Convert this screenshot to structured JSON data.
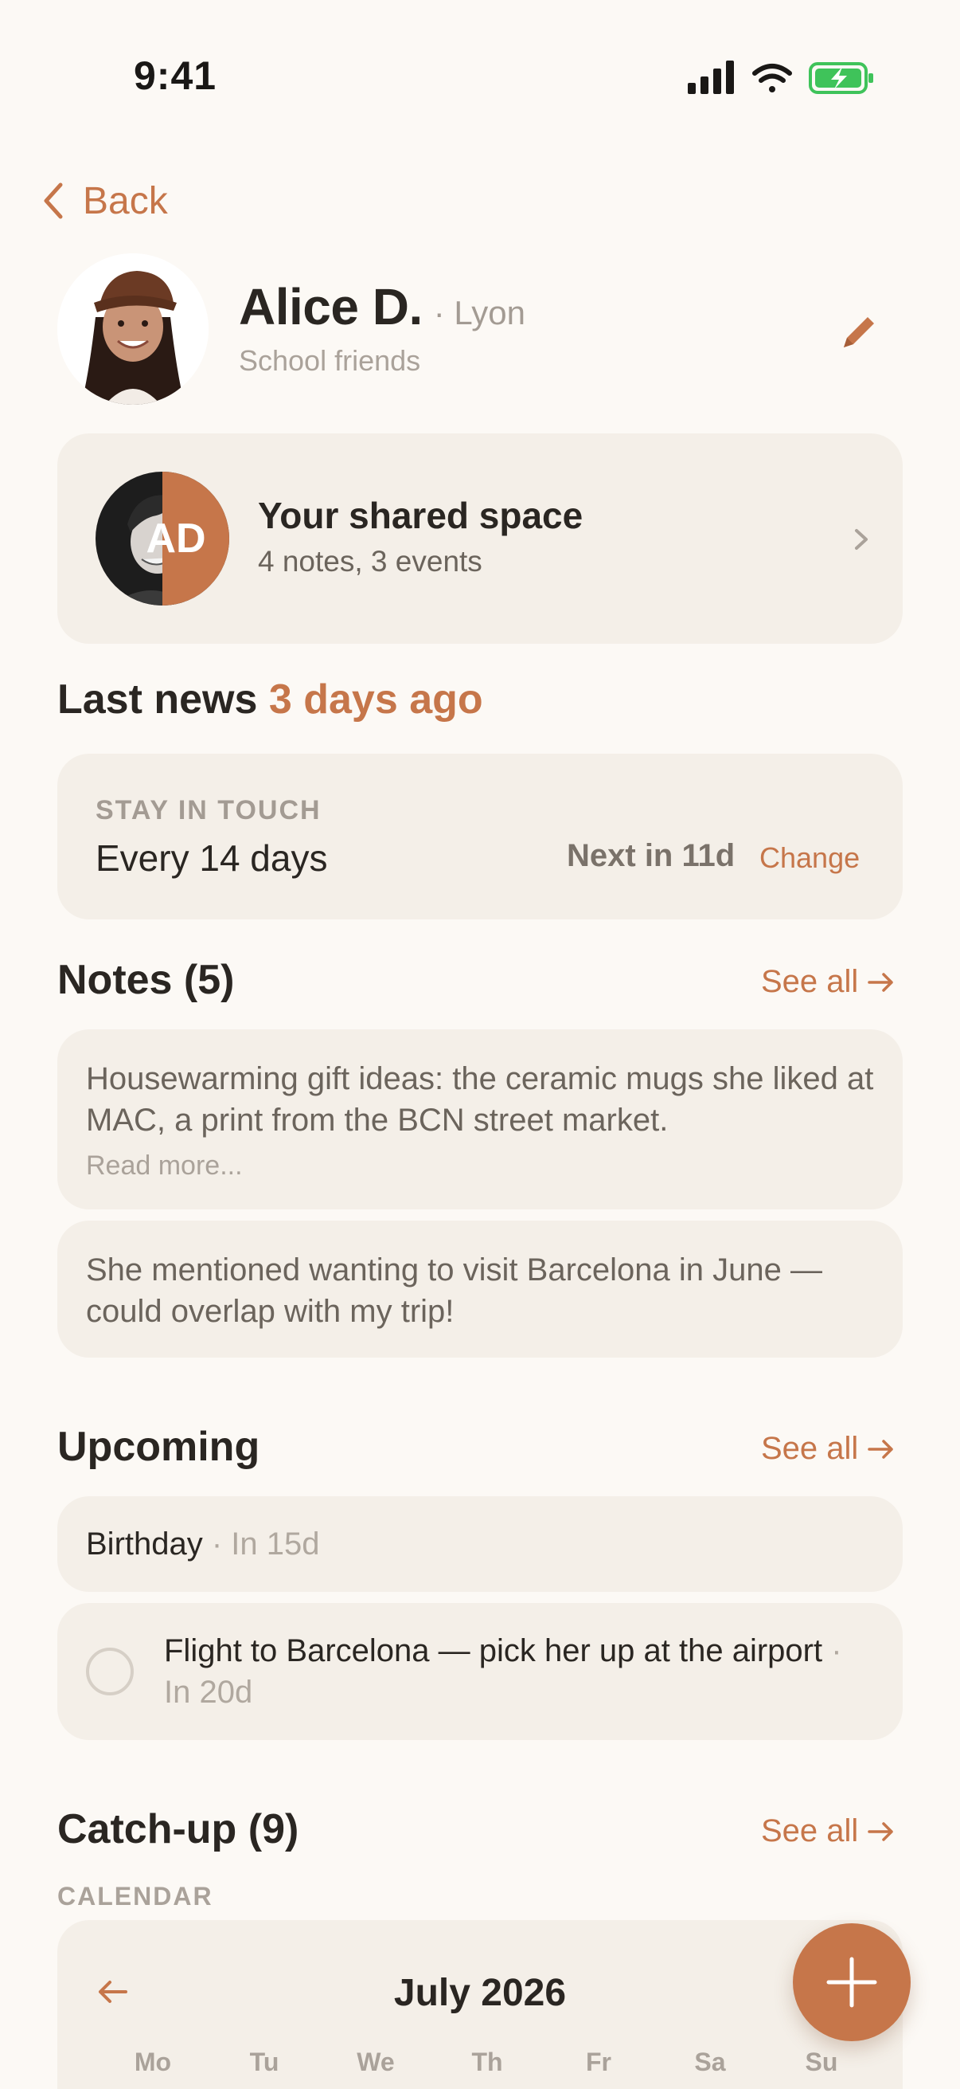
{
  "status_bar": {
    "time": "9:41",
    "battery_color": "#3fc35a"
  },
  "nav": {
    "back_label": "Back"
  },
  "profile": {
    "name": "Alice D.",
    "city": "· Lyon",
    "group": "School friends"
  },
  "shared_space": {
    "initials": "AD",
    "title": "Your shared space",
    "subtitle": "4 notes, 3 events"
  },
  "last_news": {
    "label": "Last news",
    "value": "3 days ago"
  },
  "stay_in_touch": {
    "label": "STAY IN TOUCH",
    "frequency": "Every 14 days",
    "next": "Next in 11d",
    "change_label": "Change"
  },
  "notes": {
    "title": "Notes (5)",
    "see_all": "See all",
    "items": [
      {
        "text": "Housewarming gift ideas: the ceramic mugs she liked at MAC, a print from the BCN street market.",
        "read_more": "Read more..."
      },
      {
        "text": "She mentioned wanting to visit Barcelona in June — could overlap with my trip!"
      }
    ]
  },
  "upcoming": {
    "title": "Upcoming",
    "see_all": "See all",
    "items": [
      {
        "title": "Birthday",
        "due": "· In 15d"
      },
      {
        "title": "Flight to Barcelona — pick her up at the airport",
        "due": "· In 20d"
      }
    ]
  },
  "catch_up": {
    "title": "Catch-up (9)",
    "see_all": "See all",
    "calendar_label": "CALENDAR",
    "month": "July 2026",
    "weekdays": [
      "Mo",
      "Tu",
      "We",
      "Th",
      "Fr",
      "Sa",
      "Su"
    ]
  },
  "colors": {
    "accent": "#c6764a",
    "background": "#fcf9f5",
    "card": "#f4efe8"
  },
  "icons": {
    "back": "chevron-left-icon",
    "edit": "pencil-icon",
    "chevron": "chevron-right-icon",
    "arrow": "arrow-right-icon",
    "prev": "arrow-left-icon",
    "add": "plus-icon"
  }
}
